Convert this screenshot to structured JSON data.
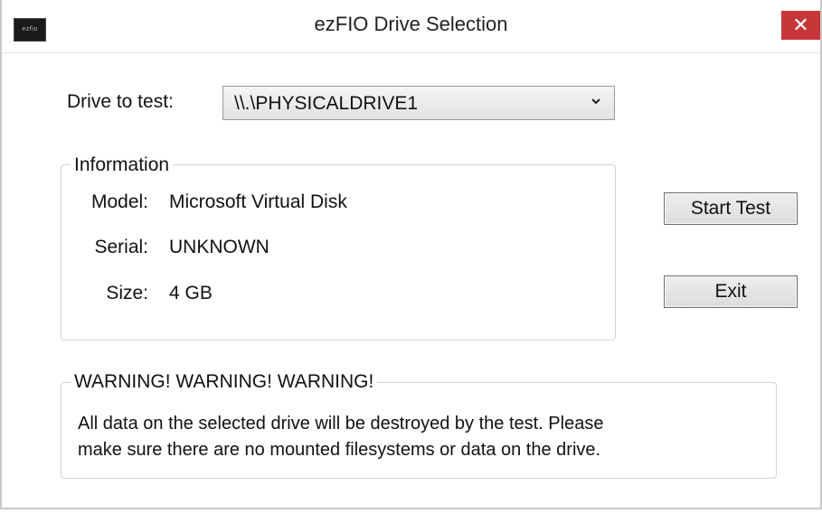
{
  "window": {
    "title": "ezFIO Drive Selection",
    "app_icon_text": "ezfio",
    "close_glyph": "✕",
    "accent_close_color": "#c7373a"
  },
  "drive": {
    "label": "Drive to test:",
    "selected": "\\\\.\\PHYSICALDRIVE1"
  },
  "information": {
    "legend": "Information",
    "rows": [
      {
        "label": "Model:",
        "value": "Microsoft Virtual Disk"
      },
      {
        "label": "Serial:",
        "value": "UNKNOWN"
      },
      {
        "label": "Size:",
        "value": "4 GB"
      }
    ]
  },
  "buttons": {
    "start": "Start Test",
    "exit": "Exit"
  },
  "warning": {
    "legend": "WARNING! WARNING! WARNING!",
    "lines": [
      "All data on the selected drive will be destroyed by the test. Please",
      "make sure there are no mounted filesystems or data on the drive."
    ]
  }
}
